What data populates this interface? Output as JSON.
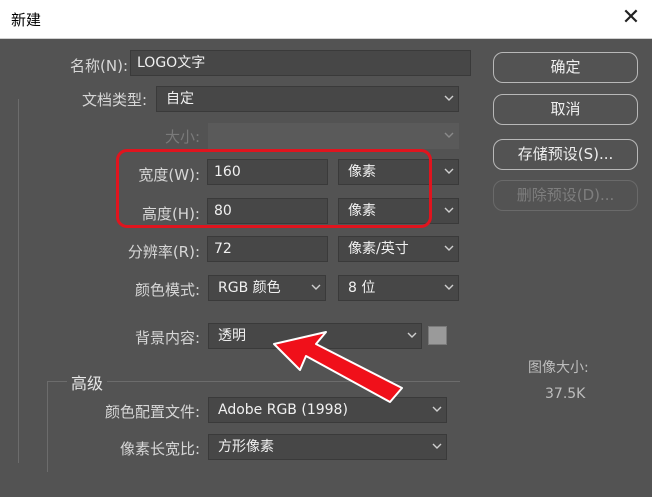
{
  "window": {
    "title": "新建"
  },
  "icons": {
    "close": "close-icon",
    "dropdown": "chevron-down-icon"
  },
  "form": {
    "name": {
      "label": "名称(N):",
      "value": "LOGO文字"
    },
    "doc_type": {
      "label": "文档类型:",
      "value": "自定"
    },
    "size": {
      "label": "大小:",
      "value": ""
    },
    "width": {
      "label": "宽度(W):",
      "value": "160",
      "unit": "像素"
    },
    "height": {
      "label": "高度(H):",
      "value": "80",
      "unit": "像素"
    },
    "resolution": {
      "label": "分辨率(R):",
      "value": "72",
      "unit": "像素/英寸"
    },
    "color_mode": {
      "label": "颜色模式:",
      "value": "RGB 颜色",
      "depth": "8 位"
    },
    "background": {
      "label": "背景内容:",
      "value": "透明"
    }
  },
  "advanced": {
    "title": "高级",
    "color_profile": {
      "label": "颜色配置文件:",
      "value": "Adobe RGB (1998)"
    },
    "pixel_aspect": {
      "label": "像素长宽比:",
      "value": "方形像素"
    }
  },
  "buttons": {
    "ok": "确定",
    "cancel": "取消",
    "save_preset": "存储预设(S)...",
    "delete_preset": "删除预设(D)..."
  },
  "image_size": {
    "label": "图像大小:",
    "value": "37.5K"
  },
  "colors": {
    "dialog_bg": "#535353",
    "highlight": "#e0141e",
    "arrow": "#f0101a"
  }
}
